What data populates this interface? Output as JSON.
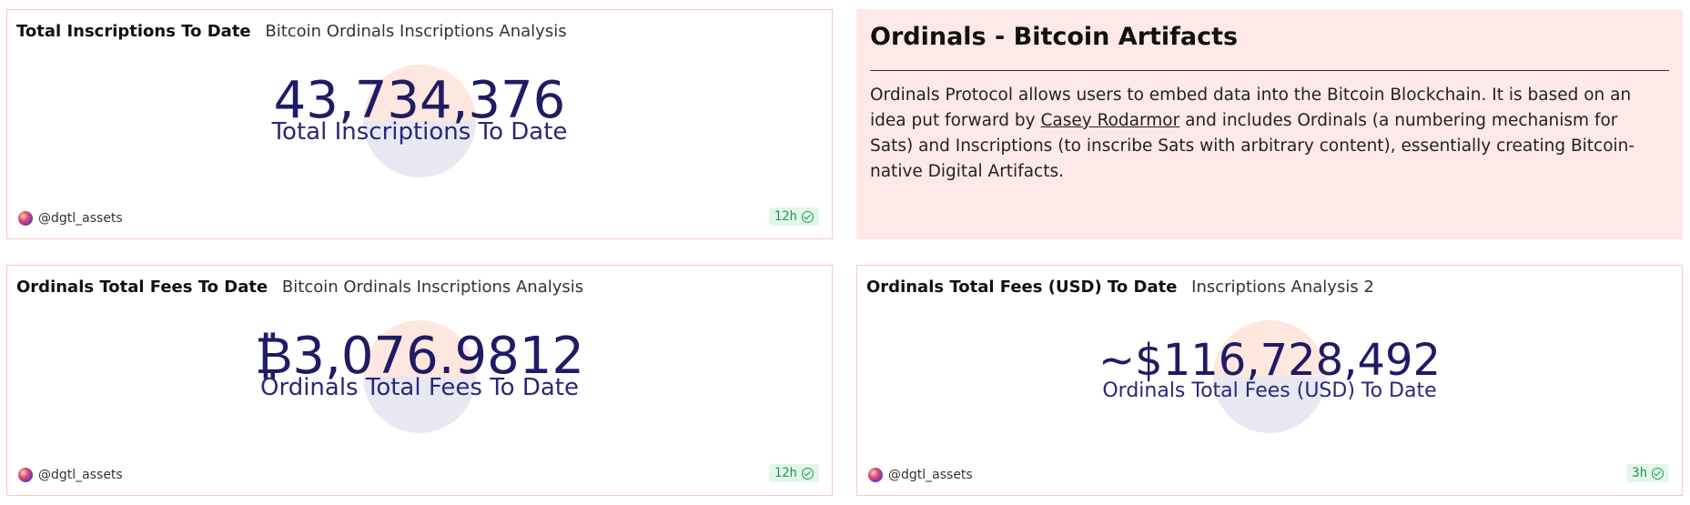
{
  "cards": {
    "total_inscriptions": {
      "title": "Total Inscriptions To Date",
      "subtitle": "Bitcoin Ordinals Inscriptions Analysis",
      "value": "43,734,376",
      "label": "Total Inscriptions To Date",
      "author": "@dgtl_assets",
      "refresh": "12h"
    },
    "artifacts": {
      "title": "Ordinals - Bitcoin Artifacts",
      "body_part1": "Ordinals Protocol allows users to embed data into the Bitcoin Blockchain. It is based on an idea put forward by ",
      "link_text": "Casey Rodarmor",
      "body_part2": " and includes Ordinals (a numbering mechanism for Sats) and Inscriptions (to inscribe Sats with arbitrary content), essentially creating Bitcoin-native Digital Artifacts."
    },
    "fees_btc": {
      "title": "Ordinals Total Fees To Date",
      "subtitle": "Bitcoin Ordinals Inscriptions Analysis",
      "value": "₿3,076.9812",
      "label": "Ordinals Total Fees To Date",
      "author": "@dgtl_assets",
      "refresh": "12h"
    },
    "fees_usd": {
      "title": "Ordinals Total Fees (USD) To Date",
      "subtitle": "Inscriptions Analysis 2",
      "value": "~$116,728,492",
      "label": "Ordinals Total Fees (USD) To Date",
      "author": "@dgtl_assets",
      "refresh": "3h"
    }
  },
  "colors": {
    "value_text": "#1f1b66",
    "card_border": "#f6c9c2",
    "text_card_bg": "#fde9e7",
    "badge_bg": "#e3f6ea",
    "badge_text": "#1e9a52"
  }
}
